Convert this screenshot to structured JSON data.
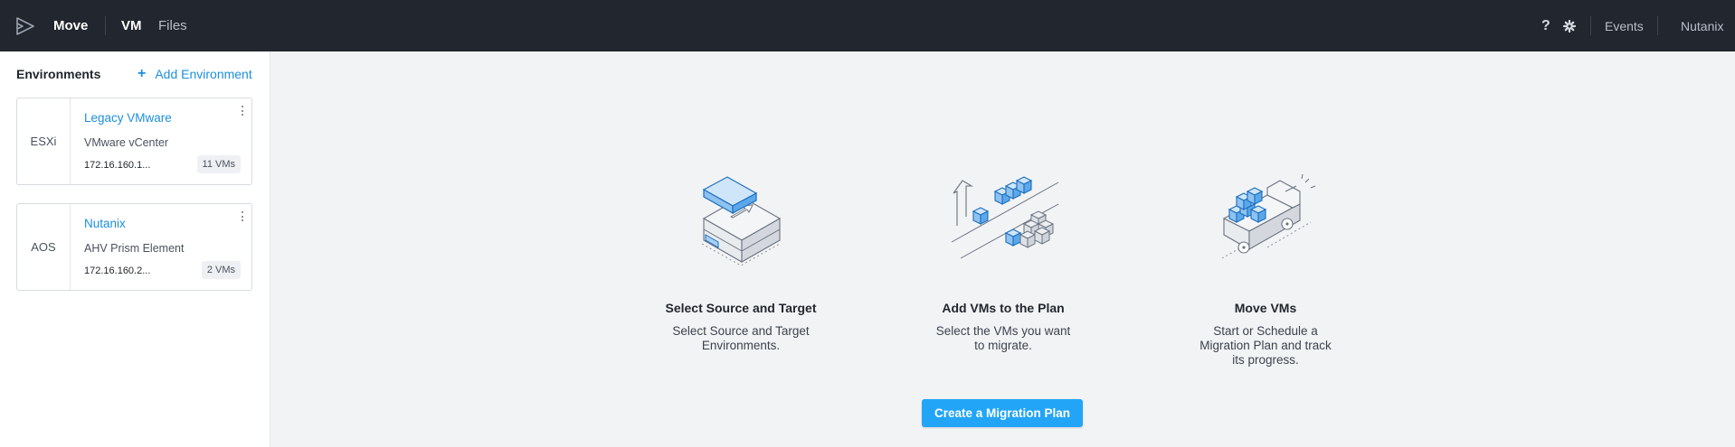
{
  "topbar": {
    "app_name": "Move",
    "nav": [
      {
        "label": "VM",
        "active": true
      },
      {
        "label": "Files",
        "active": false
      }
    ],
    "help_label": "?",
    "events_label": "Events",
    "user_label": "Nutanix"
  },
  "sidebar": {
    "title": "Environments",
    "add_label": "Add Environment",
    "environments": [
      {
        "type": "ESXi",
        "name": "Legacy VMware",
        "kind": "VMware vCenter",
        "ip": "172.16.160.1...",
        "vms": "11 VMs"
      },
      {
        "type": "AOS",
        "name": "Nutanix",
        "kind": "AHV Prism Element",
        "ip": "172.16.160.2...",
        "vms": "2 VMs"
      }
    ]
  },
  "steps": [
    {
      "title": "Select Source and Target",
      "desc": "Select Source and Target Environments.",
      "icon": "source-target-illustration"
    },
    {
      "title": "Add VMs to the Plan",
      "desc": "Select the VMs you want to migrate.",
      "icon": "add-vms-illustration"
    },
    {
      "title": "Move VMs",
      "desc": "Start or Schedule a Migration Plan and track its progress.",
      "icon": "truck-illustration"
    }
  ],
  "cta_label": "Create a Migration Plan",
  "colors": {
    "topbar": "#22262e",
    "accent": "#1b8fde",
    "button": "#22a5f7",
    "background": "#f2f3f5"
  }
}
